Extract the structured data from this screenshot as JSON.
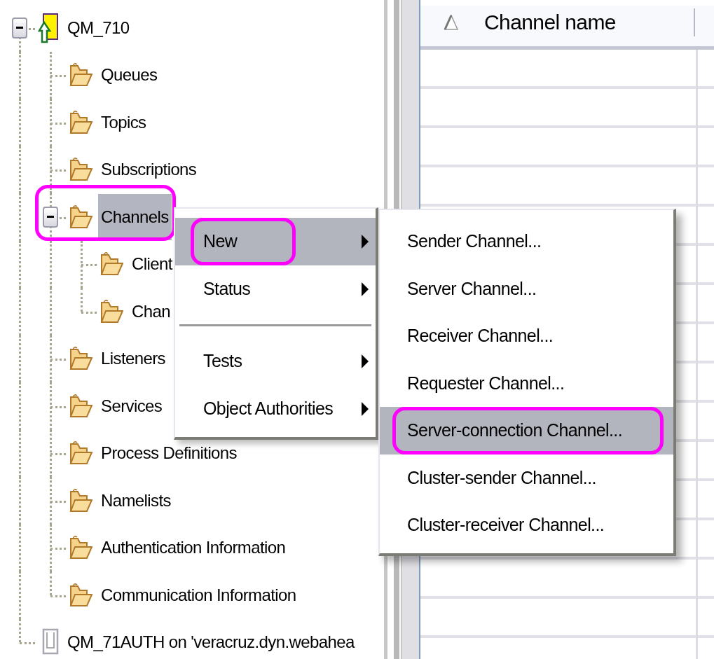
{
  "tree": [
    {
      "label": "QM_710",
      "kind": "qmgr_running",
      "expanded": true,
      "selected": false,
      "children": [
        {
          "label": "Queues",
          "kind": "folder",
          "selected": false
        },
        {
          "label": "Topics",
          "kind": "folder",
          "selected": false
        },
        {
          "label": "Subscriptions",
          "kind": "folder",
          "selected": false
        },
        {
          "label": "Channels",
          "kind": "folder",
          "expanded": true,
          "selected": true,
          "highlighted": true,
          "children": [
            {
              "label": "Client",
              "kind": "folder",
              "selected": false
            },
            {
              "label": "Chan",
              "kind": "folder",
              "selected": false
            }
          ]
        },
        {
          "label": "Listeners",
          "kind": "folder",
          "selected": false
        },
        {
          "label": "Services",
          "kind": "folder",
          "selected": false
        },
        {
          "label": "Process Definitions",
          "kind": "folder",
          "selected": false
        },
        {
          "label": "Namelists",
          "kind": "folder",
          "selected": false
        },
        {
          "label": "Authentication Information",
          "kind": "folder",
          "selected": false
        },
        {
          "label": "Communication Information",
          "kind": "folder",
          "selected": false
        }
      ]
    },
    {
      "label": "QM_71AUTH on 'veracruz.dyn.webahea",
      "kind": "qmgr_stopped",
      "selected": false
    }
  ],
  "table": {
    "columns": [
      {
        "label": "Channel name",
        "sorted_ascending": true
      }
    ]
  },
  "context_menu": {
    "items": [
      {
        "kind": "item",
        "label": "New",
        "submenu": true,
        "selected": true,
        "highlighted": true
      },
      {
        "kind": "item",
        "label": "Status",
        "submenu": true,
        "selected": false
      },
      {
        "kind": "separator"
      },
      {
        "kind": "item",
        "label": "Tests",
        "submenu": true,
        "selected": false
      },
      {
        "kind": "item",
        "label": "Object Authorities",
        "submenu": true,
        "selected": false
      }
    ]
  },
  "submenu": {
    "items": [
      {
        "label": "Sender Channel...",
        "selected": false
      },
      {
        "label": "Server Channel...",
        "selected": false
      },
      {
        "label": "Receiver Channel...",
        "selected": false
      },
      {
        "label": "Requester Channel...",
        "selected": false
      },
      {
        "label": "Server-connection Channel...",
        "selected": true,
        "highlighted": true
      },
      {
        "label": "Cluster-sender Channel...",
        "selected": false
      },
      {
        "label": "Cluster-receiver Channel...",
        "selected": false
      }
    ]
  }
}
